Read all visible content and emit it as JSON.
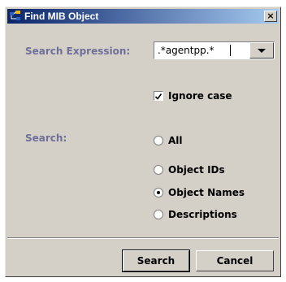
{
  "window": {
    "title": "Find MIB Object",
    "close_label": "×",
    "colors": {
      "titlebar_start": "#0a246a",
      "titlebar_end": "#a6caf0",
      "label": "#6f6f9a",
      "dialog_bg": "#d4d0c8"
    }
  },
  "search_expression": {
    "label": "Search Expression:",
    "value": ".*agentpp.*"
  },
  "ignore_case": {
    "label": "Ignore case",
    "checked": true
  },
  "search": {
    "label": "Search:",
    "options": [
      {
        "label": "All",
        "selected": false
      },
      {
        "label": "Object IDs",
        "selected": false
      },
      {
        "label": "Object Names",
        "selected": true
      },
      {
        "label": "Descriptions",
        "selected": false
      }
    ]
  },
  "buttons": {
    "search": "Search",
    "cancel": "Cancel"
  },
  "icons": {
    "app": "mib-tree-icon",
    "close": "close-icon",
    "dropdown": "chevron-down-icon",
    "check": "checkmark-icon"
  }
}
